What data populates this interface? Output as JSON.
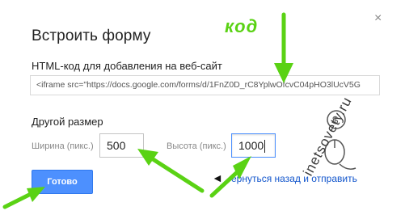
{
  "dialog": {
    "title": "Встроить форму",
    "close_label": "×",
    "embed_label": "HTML-код для добавления на веб-сайт",
    "embed_code": "<iframe src=\"https://docs.google.com/forms/d/1FnZ0D_rC8YplwOfcvC04pHO3lUcV5G",
    "size_label": "Другой размер",
    "width_label": "Ширина (пикс.)",
    "width_value": "500",
    "height_label": "Высота (пикс.)",
    "height_value": "1000",
    "done_label": "Готово",
    "back_link": "ернуться назад и отправить"
  },
  "annotations": {
    "code_note": "код",
    "arrow_color": "#5ad214",
    "watermark": "inetsovety.ru"
  },
  "colors": {
    "accent": "#4d90fe",
    "link": "#1155cc"
  }
}
